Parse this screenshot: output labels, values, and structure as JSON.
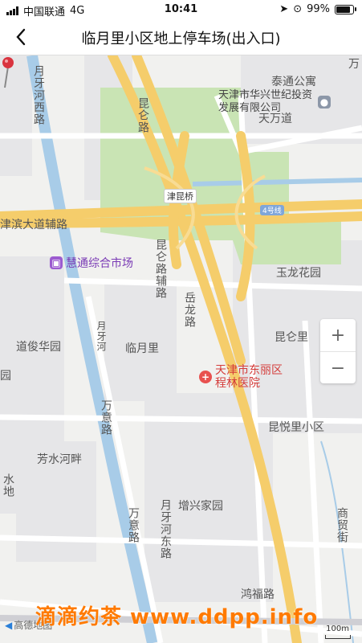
{
  "status": {
    "carrier": "中国联通",
    "network": "4G",
    "time": "10:41",
    "battery": "99%",
    "battery_level": 0.99
  },
  "nav": {
    "title": "临月里小区地上停车场(出入口)"
  },
  "map": {
    "labels": {
      "jinkunqiao": "津昆桥",
      "road_4": "4号线",
      "tongxin_park": "天津市华兴世纪投资发展有限公司",
      "taitong": "泰通公寓",
      "tianwan": "天万道",
      "yuehehe_west": "月牙河西路",
      "kunlun_road": "昆仑路",
      "jinbin_fulu": "津滨大道辅路",
      "huitong_market": "慧通综合市场",
      "kunlun_fulu": "昆仑路辅路",
      "yuelong": "玉龙花园",
      "taolong": "岳龙路",
      "kunlunli": "昆仑里",
      "daojunhua": "道俊华园",
      "linyueli": "临月里",
      "yueyahe": "月牙河",
      "hospital": "天津市东丽区程林医院",
      "kunyueli": "昆悦里小区",
      "wanyi_road": "万意路",
      "fangshui": "芳水河畔",
      "zengxing": "增兴家园",
      "wanyi_road2": "万意路",
      "yueyahe_east": "月牙河东路",
      "shangmao": "商贸街",
      "hongfu": "鸿福路",
      "left_edge_1": "园",
      "left_edge_2": "水地",
      "right_top": "万"
    },
    "zoom": {
      "plus": "+",
      "minus": "−"
    },
    "watermark": "滴滴约茶 www.ddpp.info",
    "logo": "高德地图",
    "scale": "100m"
  },
  "colors": {
    "highway": "#f5cd6b",
    "river": "#a8cce8",
    "green": "#c9e4b4",
    "pin": "#d9343f",
    "hospital": "#e8514f",
    "market": "#9c5bd0"
  }
}
